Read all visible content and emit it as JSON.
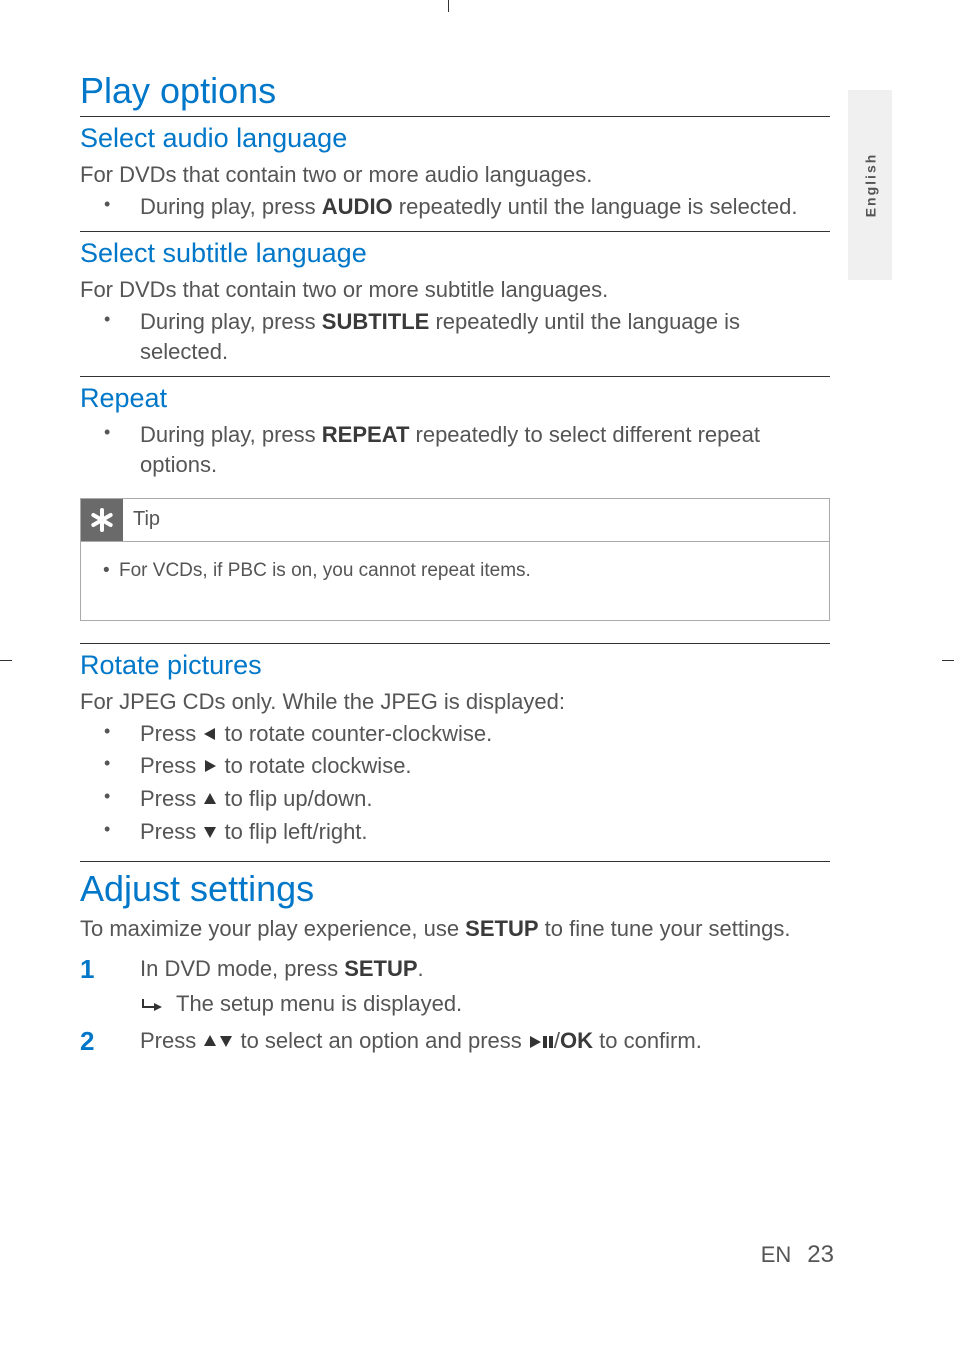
{
  "lang_tab": "English",
  "h1_play": "Play options",
  "sec_audio": {
    "title": "Select audio language",
    "intro": "For DVDs that contain two or more audio languages.",
    "item_pre": "During play, press ",
    "item_bold": "AUDIO",
    "item_post": " repeatedly until the language is selected."
  },
  "sec_subtitle": {
    "title": "Select subtitle language",
    "intro": "For DVDs that contain two or more subtitle languages.",
    "item_pre": "During play, press ",
    "item_bold": "SUBTITLE",
    "item_post": " repeatedly until the language is selected."
  },
  "sec_repeat": {
    "title": "Repeat",
    "item_pre": "During play, press ",
    "item_bold": "REPEAT",
    "item_post": " repeatedly to select different repeat options."
  },
  "tip": {
    "label": "Tip",
    "body": "For VCDs, if PBC is on, you cannot repeat items."
  },
  "sec_rotate": {
    "title": "Rotate pictures",
    "intro": "For JPEG CDs only. While the JPEG is displayed:",
    "i1_pre": "Press ",
    "i1_post": " to rotate counter-clockwise.",
    "i2_pre": "Press ",
    "i2_post": " to rotate clockwise.",
    "i3_pre": "Press ",
    "i3_post": " to flip up/down.",
    "i4_pre": "Press ",
    "i4_post": " to flip left/right."
  },
  "h1_adjust": "Adjust settings",
  "adjust_intro_pre": "To maximize your play experience, use ",
  "adjust_intro_bold": "SETUP",
  "adjust_intro_post": " to fine tune your settings.",
  "step1_num": "1",
  "step1_pre": "In DVD mode, press ",
  "step1_bold": "SETUP",
  "step1_post": ".",
  "step1_sub": "The setup menu is displayed.",
  "step2_num": "2",
  "step2_pre": "Press ",
  "step2_mid": " to select an option and press ",
  "step2_ok": "OK",
  "step2_post": " to confirm.",
  "footer_lang": "EN",
  "footer_page": "23"
}
